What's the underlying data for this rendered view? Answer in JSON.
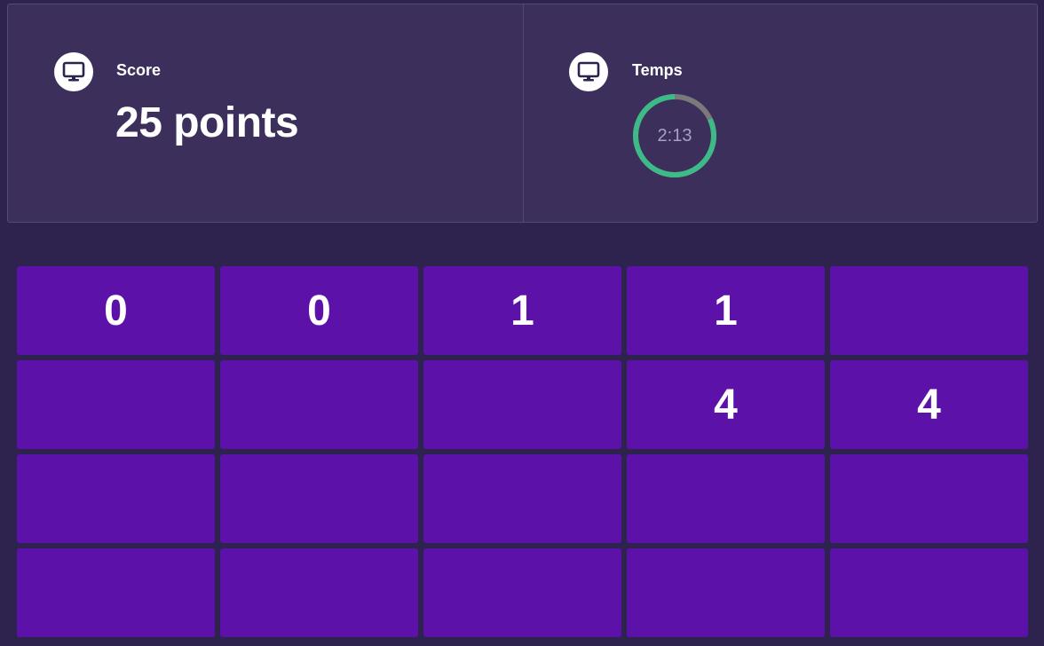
{
  "score": {
    "label": "Score",
    "value": "25 points",
    "icon": "monitor-icon"
  },
  "time": {
    "label": "Temps",
    "value": "2:13",
    "remaining_fraction": 0.82,
    "icon": "monitor-icon",
    "colors": {
      "remaining": "#3dba86",
      "elapsed": "#7a7a7a"
    }
  },
  "board": {
    "columns": 5,
    "rows": 4,
    "tiles": [
      "0",
      "0",
      "1",
      "1",
      "",
      "",
      "",
      "",
      "4",
      "4",
      "",
      "",
      "",
      "",
      "",
      "",
      "",
      "",
      "",
      ""
    ]
  },
  "colors": {
    "background": "#2e224f",
    "panel": "#3c2f5c",
    "tile": "#5c12a9"
  }
}
